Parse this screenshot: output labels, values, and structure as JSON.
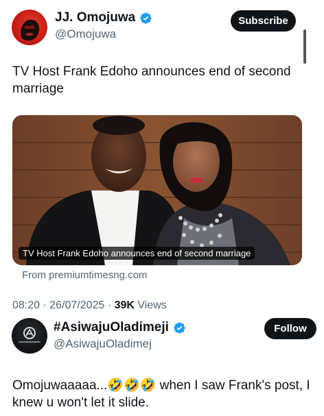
{
  "tweet": {
    "author_name": "JJ. Omojuwa",
    "author_handle": "@Omojuwa",
    "subscribe_label": "Subscribe",
    "text": "TV Host Frank Edoho announces end of second marriage",
    "card": {
      "caption": "TV Host Frank Edoho announces end of second marriage",
      "source": "From premiumtimesng.com"
    },
    "time": "08:20",
    "date": "26/07/2025",
    "views_count": "39K",
    "views_label": "Views"
  },
  "reply": {
    "author_name": "#AsiwajuOladimeji",
    "author_handle": "@AsiwajuOladimej",
    "follow_label": "Follow",
    "text": "Omojuwaaaaa...🤣🤣🤣 when I saw Frank's post, I knew u won't let it slide."
  },
  "colors": {
    "verified": "#1d9bf0",
    "button_bg": "#0f1419",
    "secondary_text": "#536471"
  },
  "icons": {
    "verified": "verified-badge-icon"
  }
}
